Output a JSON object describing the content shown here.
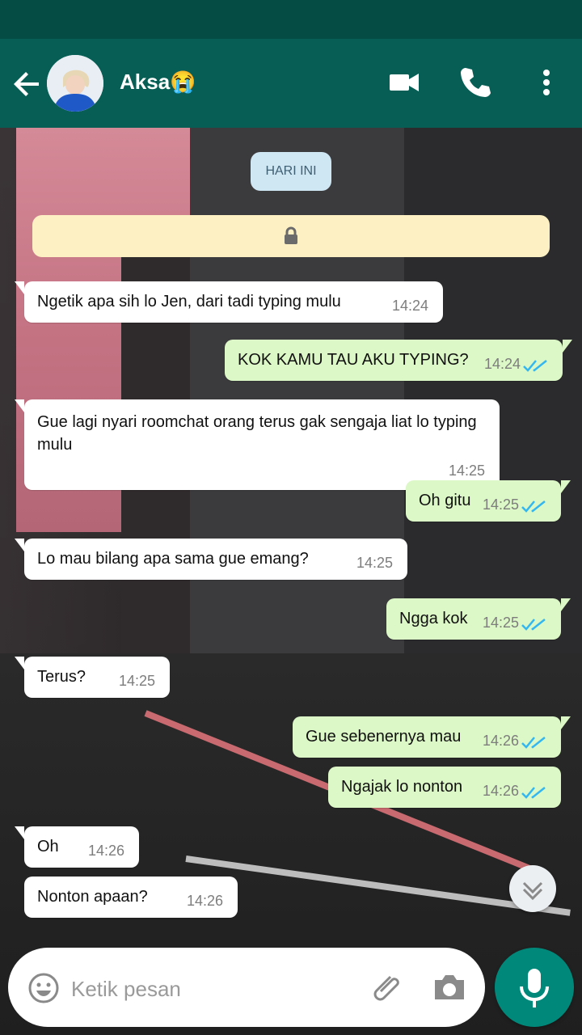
{
  "contact": {
    "name": "Aksa😭"
  },
  "chat": {
    "date_chip": "HARI INI",
    "messages": [
      {
        "dir": "in",
        "text": "Ngetik apa sih lo Jen, dari tadi typing mulu",
        "time": "14:24"
      },
      {
        "dir": "out",
        "text": "KOK KAMU TAU AKU TYPING?",
        "time": "14:24"
      },
      {
        "dir": "in",
        "text": "Gue lagi nyari roomchat orang terus gak sengaja liat lo typing mulu",
        "time": "14:25"
      },
      {
        "dir": "out",
        "text": "Oh gitu",
        "time": "14:25"
      },
      {
        "dir": "in",
        "text": "Lo mau bilang apa sama gue emang?",
        "time": "14:25"
      },
      {
        "dir": "out",
        "text": "Ngga kok",
        "time": "14:25"
      },
      {
        "dir": "in",
        "text": "Terus?",
        "time": "14:25"
      },
      {
        "dir": "out",
        "text": "Gue sebenernya mau",
        "time": "14:26"
      },
      {
        "dir": "out",
        "text": "Ngajak lo nonton",
        "time": "14:26"
      },
      {
        "dir": "in",
        "text": "Oh",
        "time": "14:26"
      },
      {
        "dir": "in",
        "text": "Nonton apaan?",
        "time": "14:26"
      }
    ]
  },
  "input": {
    "placeholder": "Ketik pesan"
  },
  "icons": {
    "back": "back-arrow-icon",
    "video": "video-call-icon",
    "voice": "phone-call-icon",
    "menu": "more-vertical-icon",
    "emoji": "emoji-icon",
    "attach": "paperclip-icon",
    "camera": "camera-icon",
    "mic": "microphone-icon",
    "scroll": "chevron-double-down-icon",
    "lock": "lock-icon",
    "read": "double-check-icon"
  },
  "colors": {
    "appbar": "#075e54",
    "statusbar": "#054d44",
    "outgoing_bubble": "#dcf8c6",
    "incoming_bubble": "#ffffff",
    "read_ticks": "#34b7f1",
    "mic_button": "#00897b"
  }
}
